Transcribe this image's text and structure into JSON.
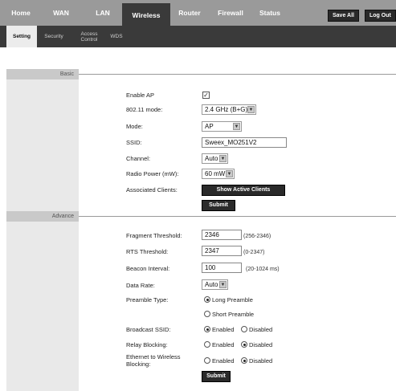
{
  "nav": {
    "tabs": [
      "Home",
      "WAN",
      "LAN",
      "Wireless",
      "Router",
      "Firewall",
      "Status"
    ],
    "active": "Wireless",
    "save_all": "Save All",
    "log_out": "Log Out"
  },
  "subnav": {
    "tabs": [
      "Setting",
      "Security",
      "Access Control",
      "WDS"
    ],
    "active": "Setting"
  },
  "basic": {
    "section_label": "Basic",
    "enable_ap_label": "Enable AP",
    "enable_ap_checked": true,
    "mode_80211_label": "802.11 mode:",
    "mode_80211_value": "2.4 GHz (B+G)",
    "mode_label": "Mode:",
    "mode_value": "AP",
    "ssid_label": "SSID:",
    "ssid_value": "Sweex_MO251V2",
    "channel_label": "Channel:",
    "channel_value": "Auto",
    "radio_power_label": "Radio Power (mW):",
    "radio_power_value": "60 mW",
    "assoc_clients_label": "Associated Clients:",
    "show_clients_button": "Show Active Clients",
    "submit_label": "Submit"
  },
  "advance": {
    "section_label": "Advance",
    "frag_label": "Fragment Threshold:",
    "frag_value": "2346",
    "frag_hint": "(256-2346)",
    "rts_label": "RTS Threshold:",
    "rts_value": "2347",
    "rts_hint": "(0-2347)",
    "beacon_label": "Beacon Interval:",
    "beacon_value": "100",
    "beacon_hint": "(20-1024 ms)",
    "data_rate_label": "Data Rate:",
    "data_rate_value": "Auto",
    "preamble_label": "Preamble Type:",
    "preamble_long": "Long Preamble",
    "preamble_short": "Short Preamble",
    "preamble_selected": "long",
    "broadcast_label": "Broadcast SSID:",
    "broadcast_selected": "enabled",
    "relay_label": "Relay Blocking:",
    "relay_selected": "disabled",
    "eth_label_line1": "Ethernet to Wireless",
    "eth_label_line2": "Blocking:",
    "eth_selected": "disabled",
    "enabled_text": "Enabled",
    "disabled_text": "Disabled",
    "submit_label": "Submit"
  }
}
